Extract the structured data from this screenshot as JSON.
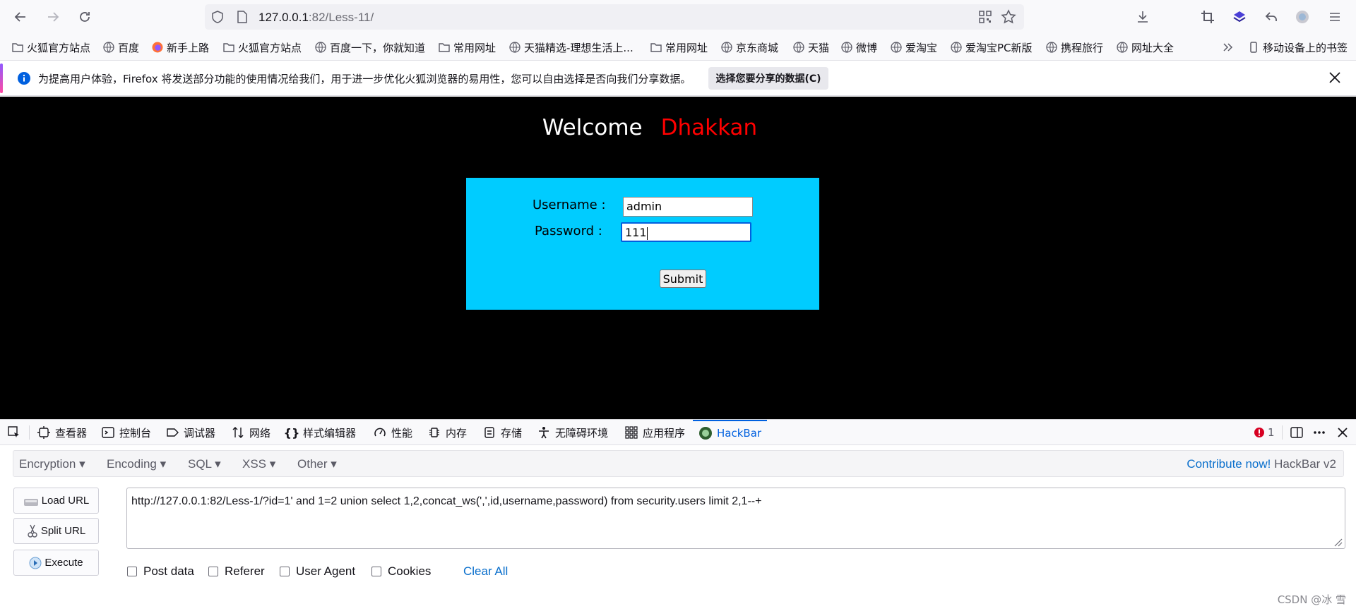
{
  "nav": {
    "url_host": "127.0.0.1",
    "url_rest": ":82/Less-11/"
  },
  "bookmarks": [
    {
      "label": "火狐官方站点",
      "icon": "folder-icon"
    },
    {
      "label": "百度",
      "icon": "globe-icon"
    },
    {
      "label": "新手上路",
      "icon": "firefox-icon"
    },
    {
      "label": "火狐官方站点",
      "icon": "folder-icon"
    },
    {
      "label": "百度一下，你就知道",
      "icon": "globe-icon"
    },
    {
      "label": "常用网址",
      "icon": "folder-icon"
    },
    {
      "label": "天猫精选-理想生活上...",
      "icon": "globe-icon"
    },
    {
      "label": "常用网址",
      "icon": "folder-icon"
    },
    {
      "label": "京东商城",
      "icon": "globe-icon"
    },
    {
      "label": "天猫",
      "icon": "globe-icon"
    },
    {
      "label": "微博",
      "icon": "globe-icon"
    },
    {
      "label": "爱淘宝",
      "icon": "globe-icon"
    },
    {
      "label": "爱淘宝PC新版",
      "icon": "globe-icon"
    },
    {
      "label": "携程旅行",
      "icon": "globe-icon"
    },
    {
      "label": "网址大全",
      "icon": "globe-icon"
    }
  ],
  "mobile_bookmarks": "移动设备上的书签",
  "notification": {
    "text": "为提高用户体验，Firefox 将发送部分功能的使用情况给我们，用于进一步优化火狐浏览器的易用性，您可以自由选择是否向我们分享数据。",
    "button": "选择您要分享的数据(C)"
  },
  "page": {
    "welcome": "Welcome",
    "name": "Dhakkan",
    "username_label": "Username :",
    "username_value": "admin",
    "password_label": "Password :",
    "password_value": "111",
    "submit": "Submit"
  },
  "devtools": {
    "tabs": [
      "查看器",
      "控制台",
      "调试器",
      "网络",
      "样式编辑器",
      "性能",
      "内存",
      "存储",
      "无障碍环境",
      "应用程序",
      "HackBar"
    ],
    "error_count": "1"
  },
  "hackbar": {
    "menus": [
      "Encryption",
      "Encoding",
      "SQL",
      "XSS",
      "Other"
    ],
    "contribute": "Contribute now!",
    "version": "HackBar v2",
    "load_url": "Load URL",
    "split_url": "Split URL",
    "execute": "Execute",
    "url_value": "http://127.0.0.1:82/Less-1/?id=1' and 1=2 union select 1,2,concat_ws(',',id,username,password) from security.users limit 2,1--+",
    "checks": [
      "Post data",
      "Referer",
      "User Agent",
      "Cookies"
    ],
    "clear_all": "Clear All"
  },
  "watermark": "CSDN @冰 雪",
  "colors": {
    "page_bg": "#000000",
    "login_box": "#00ccff",
    "dhakkan": "#ff0000",
    "link": "#0a6fcc",
    "active_tab": "#0060df"
  }
}
